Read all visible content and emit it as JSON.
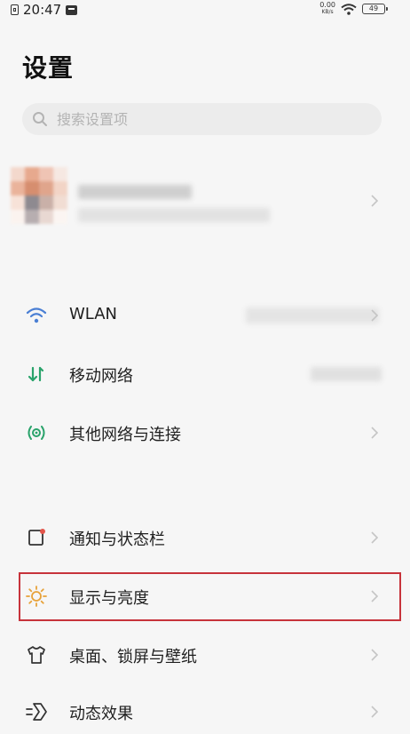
{
  "status_bar": {
    "time": "20:47",
    "net_speed_value": "0.00",
    "net_speed_unit": "KB/s",
    "battery": "49"
  },
  "page": {
    "title": "设置"
  },
  "search": {
    "placeholder": "搜索设置项"
  },
  "list": {
    "wlan": {
      "label": "WLAN",
      "icon": "wifi-icon",
      "color": "#4a7fd4"
    },
    "mobile_network": {
      "label": "移动网络",
      "icon": "mobile-data-icon",
      "color": "#2aa36b"
    },
    "other_network": {
      "label": "其他网络与连接",
      "icon": "connection-icon",
      "color": "#2aa36b"
    },
    "notification": {
      "label": "通知与状态栏",
      "icon": "notification-icon"
    },
    "display": {
      "label": "显示与亮度",
      "icon": "sun-icon",
      "color": "#e7a23a"
    },
    "desktop": {
      "label": "桌面、锁屏与壁纸",
      "icon": "shirt-icon"
    },
    "animation": {
      "label": "动态效果",
      "icon": "animation-icon"
    }
  },
  "colors": {
    "highlight_border": "#c7333b",
    "background": "#f6f6f6"
  }
}
